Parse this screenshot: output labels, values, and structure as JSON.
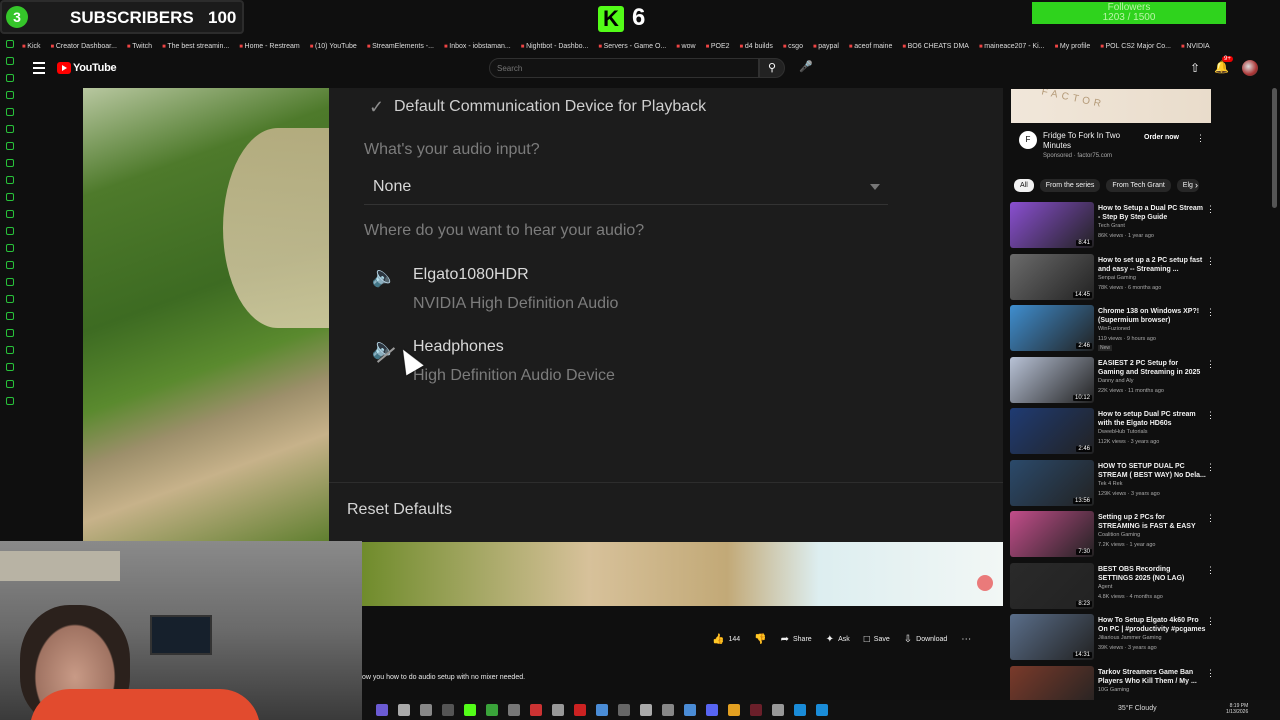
{
  "overlay": {
    "subs_badge": "3",
    "subs_label": "SUBSCRIBERS",
    "subs_count": "100",
    "kick_logo": "K",
    "kick_count": "6",
    "followers_label": "Followers",
    "followers_count": "1203 / 1500"
  },
  "bookmarks": [
    "Kick",
    "Creator Dashboar...",
    "Twitch",
    "The best streamin...",
    "Home - Restream",
    "(10) YouTube",
    "StreamElements -...",
    "Inbox - iobstaman...",
    "Nightbot - Dashbo...",
    "Servers - Game O...",
    "wow",
    "POE2",
    "d4 builds",
    "csgo",
    "paypal",
    "aceof maine",
    "BO6 CHEATS DMA",
    "maineace207 - Ki...",
    "My profile",
    "POL CS2 Major Co...",
    "NVIDIA"
  ],
  "youtube": {
    "logo_text": "YouTube",
    "search_placeholder": "Search",
    "search_icon": "search-icon",
    "notifications_badge": "9+"
  },
  "settings_panel": {
    "default_device_label": "Default Communication Device for Playback",
    "input_question": "What's your audio input?",
    "input_value": "None",
    "output_question": "Where do you want to hear your audio?",
    "devices": [
      {
        "name": "Elgato1080HDR",
        "subtitle": "NVIDIA High Definition Audio",
        "icon": "speaker-icon"
      },
      {
        "name": "Headphones",
        "subtitle": "High Definition Audio Device",
        "icon": "muted-speaker-icon"
      }
    ],
    "reset_label": "Reset Defaults"
  },
  "video": {
    "description_snippet": "ow you how to do audio setup with no mixer needed.",
    "actions": {
      "like_count": "144",
      "share_label": "Share",
      "ask_label": "Ask",
      "save_label": "Save",
      "download_label": "Download"
    }
  },
  "ad": {
    "image_text": "FACTOR",
    "icon_text": "F",
    "title": "Fridge To Fork In Two Minutes",
    "sponsor": "Sponsored · factor75.com",
    "cta": "Order now"
  },
  "chips": [
    "All",
    "From the series",
    "From Tech Grant",
    "Elg"
  ],
  "recommendations": [
    {
      "title": "How to Setup a Dual PC Stream - Step By Step Guide",
      "channel": "Tech Grant",
      "meta": "86K views · 1 year ago",
      "duration": "8:41",
      "thumb": "#8a4fd1"
    },
    {
      "title": "How to set up a 2 PC setup fast and easy -- Streaming ...",
      "channel": "Senpai Gaming",
      "meta": "78K views · 6 months ago",
      "duration": "14:45",
      "thumb": "#6b6b6b"
    },
    {
      "title": "Chrome 138 on Windows XP?! (Supermium browser)",
      "channel": "WinFuzioned",
      "meta": "119 views · 9 hours ago",
      "duration": "2:46",
      "thumb": "#3f8ecf",
      "badge": "New"
    },
    {
      "title": "EASIEST 2 PC Setup for Gaming and Streaming in 2025",
      "channel": "Danny and Aly",
      "meta": "22K views · 11 months ago",
      "duration": "10:12",
      "thumb": "#b8c2d6"
    },
    {
      "title": "How to setup Dual PC stream with the Elgato HD60s",
      "channel": "DweebHub Tutorials",
      "meta": "112K views · 3 years ago",
      "duration": "2:46",
      "thumb": "#1f3b73"
    },
    {
      "title": "HOW TO SETUP DUAL PC STREAM ( BEST WAY) No Dela...",
      "channel": "Tek 4 Rek",
      "meta": "129K views · 3 years ago",
      "duration": "13:56",
      "thumb": "#2b4a6b"
    },
    {
      "title": "Setting up 2 PCs for STREAMING is FAST & EASY",
      "channel": "Coalition Gaming",
      "meta": "7.2K views · 1 year ago",
      "duration": "7:30",
      "thumb": "#c24d8a"
    },
    {
      "title": "BEST OBS Recording SETTINGS 2025 (NO LAG)",
      "channel": "Agent",
      "meta": "4.8K views · 4 months ago",
      "duration": "8:23",
      "thumb": "#2a2a2a"
    },
    {
      "title": "How To Setup Elgato 4k60 Pro On PC | #productivity #pcgames",
      "channel": "Jiliarious Jammer Gaming",
      "meta": "39K views · 3 years ago",
      "duration": "14:31",
      "thumb": "#5a6e8a"
    },
    {
      "title": "Tarkov Streamers Game Ban Players Who Kill Them / My ...",
      "channel": "10G Gaming",
      "meta": "",
      "duration": "",
      "thumb": "#7a3a2a"
    }
  ],
  "tray": {
    "weather": "35°F  Cloudy",
    "time": "8:19 PM",
    "date": "1/13/2026"
  },
  "colors": {
    "accent_green": "#53fc18",
    "youtube_red": "#ff0000",
    "panel_bg": "#1c1c1c"
  }
}
